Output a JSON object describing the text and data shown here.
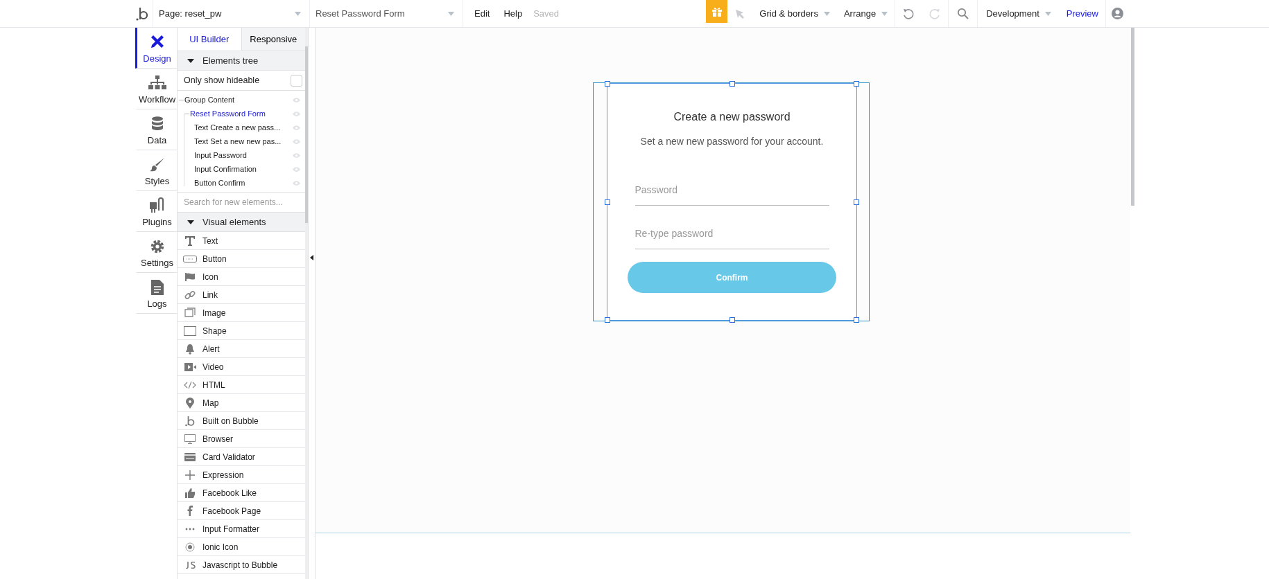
{
  "topbar": {
    "page_selector": "Page: reset_pw",
    "element_selector": "Reset Password Form",
    "menu": [
      "Edit",
      "Help"
    ],
    "save_status": "Saved",
    "grid_menu": "Grid & borders",
    "arrange_menu": "Arrange",
    "undo_disabled": false,
    "redo_disabled": true,
    "environment": "Development",
    "preview": "Preview"
  },
  "rail": [
    {
      "label": "Design",
      "selected": true
    },
    {
      "label": "Workflow",
      "selected": false
    },
    {
      "label": "Data",
      "selected": false
    },
    {
      "label": "Styles",
      "selected": false
    },
    {
      "label": "Plugins",
      "selected": false
    },
    {
      "label": "Settings",
      "selected": false
    },
    {
      "label": "Logs",
      "selected": false
    }
  ],
  "panel": {
    "tabs": [
      {
        "label": "UI Builder",
        "selected": true
      },
      {
        "label": "Responsive",
        "selected": false
      }
    ],
    "elements_tree": {
      "title": "Elements tree",
      "expanded": true,
      "filter_label": "Only show hideable",
      "filter_checked": false,
      "nodes": [
        {
          "label": "Group Content",
          "selected": false,
          "children": [
            {
              "label": "Reset Password Form",
              "selected": true,
              "children": [
                {
                  "label": "Text Create a new pass...",
                  "selected": false
                },
                {
                  "label": "Text Set a new new pas...",
                  "selected": false
                },
                {
                  "label": "Input Password",
                  "selected": false
                },
                {
                  "label": "Input Confirmation",
                  "selected": false
                },
                {
                  "label": "Button Confirm",
                  "selected": false
                }
              ]
            }
          ]
        }
      ]
    },
    "search": {
      "placeholder": "Search for new elements..."
    },
    "visual_elements": {
      "title": "Visual elements",
      "expanded": true,
      "items": [
        "Text",
        "Button",
        "Icon",
        "Link",
        "Image",
        "Shape",
        "Alert",
        "Video",
        "HTML",
        "Map",
        "Built on Bubble",
        "Browser",
        "Card Validator",
        "Expression",
        "Facebook Like",
        "Facebook Page",
        "Input Formatter",
        "Ionic Icon",
        "Javascript to Bubble"
      ]
    }
  },
  "canvas": {
    "form": {
      "selected": true,
      "title": "Create a new password",
      "subtitle": "Set a new new password for your account.",
      "fields": [
        {
          "placeholder": "Password"
        },
        {
          "placeholder": "Re-type password"
        }
      ],
      "button": "Confirm"
    }
  }
}
